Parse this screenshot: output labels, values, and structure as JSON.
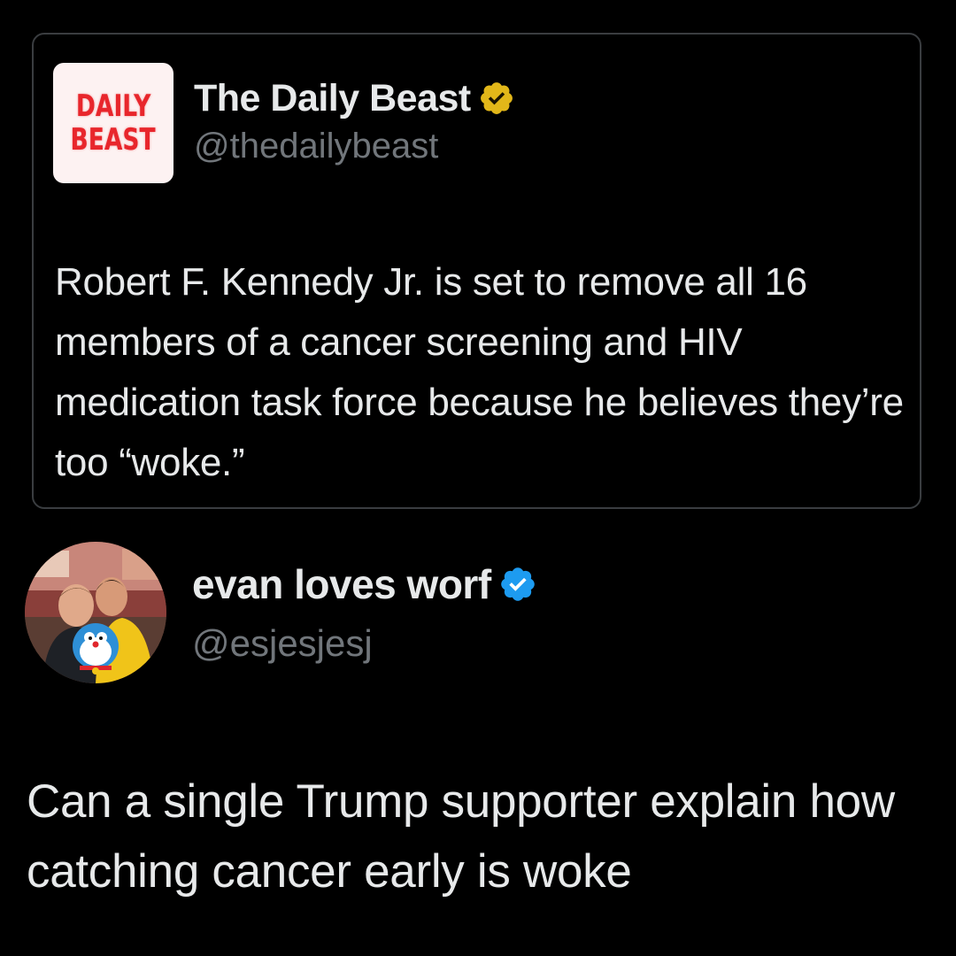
{
  "quoted_tweet": {
    "logo_line1": "DAILY",
    "logo_line2": "BEAST",
    "author_name": "The Daily Beast",
    "handle": "@thedailybeast",
    "badge_icon": "verified-gold-badge-icon",
    "badge_color": "#e2b719",
    "text": "Robert F. Kennedy Jr. is set to remove all 16 members of a cancer screening and HIV medication task force because he believes they’re too “woke.”"
  },
  "tweet": {
    "author_name": "evan loves worf",
    "handle": "@esjesjesj",
    "badge_icon": "verified-blue-badge-icon",
    "badge_color": "#1d9bf0",
    "text": "Can a single Trump supporter explain how catching cancer early is woke"
  },
  "colors": {
    "background": "#000000",
    "primary_text": "#e7e9ea",
    "secondary_text": "#71767b",
    "card_border": "#3a3d40",
    "logo_red": "#e8262c"
  }
}
